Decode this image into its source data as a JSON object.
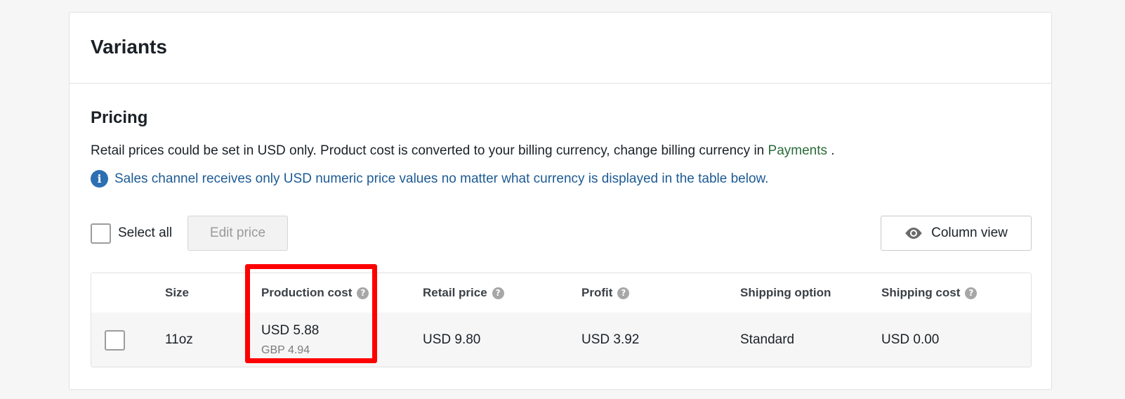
{
  "card": {
    "title": "Variants"
  },
  "pricing": {
    "title": "Pricing",
    "description": "Retail prices could be set in USD only. Product cost is converted to your billing currency, change billing currency in",
    "payments_link": "Payments",
    "description_end": ".",
    "info_icon": "info-icon",
    "info_text": "Sales channel receives only USD numeric price values no matter what currency is displayed in the table below."
  },
  "toolbar": {
    "select_all_label": "Select all",
    "edit_price_label": "Edit price",
    "column_view_label": "Column view",
    "column_view_icon": "eye-icon"
  },
  "table": {
    "headers": {
      "size": "Size",
      "production_cost": "Production cost",
      "retail_price": "Retail price",
      "profit": "Profit",
      "shipping_option": "Shipping option",
      "shipping_cost": "Shipping cost"
    },
    "help_glyph": "?",
    "rows": [
      {
        "size": "11oz",
        "production_cost": "USD 5.88",
        "production_cost_secondary": "GBP 4.94",
        "retail_price": "USD 9.80",
        "profit": "USD 3.92",
        "shipping_option": "Standard",
        "shipping_cost": "USD 0.00"
      }
    ]
  },
  "colors": {
    "highlight": "#ff0000",
    "link": "#2a6b3a",
    "info": "#1d5b94"
  }
}
